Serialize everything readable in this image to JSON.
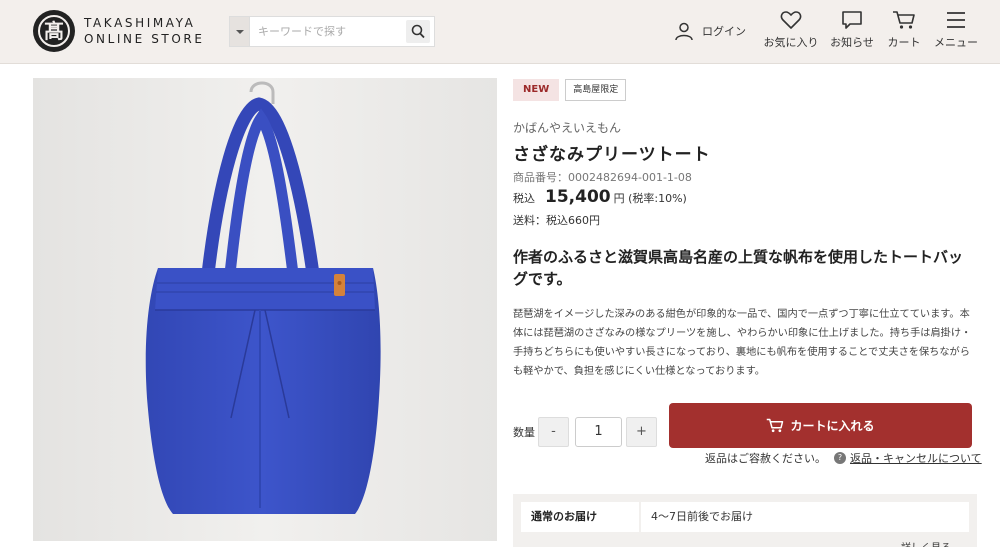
{
  "header": {
    "logo": {
      "mark": "髙",
      "line1": "TAKASHIMAYA",
      "line2": "ONLINE STORE"
    },
    "search": {
      "placeholder": "キーワードで探す"
    },
    "login_label": "ログイン",
    "icons": [
      {
        "name": "favorites",
        "label": "お気に入り"
      },
      {
        "name": "notifications",
        "label": "お知らせ"
      },
      {
        "name": "cart",
        "label": "カート"
      },
      {
        "name": "menu",
        "label": "メニュー"
      }
    ]
  },
  "product": {
    "badge_new": "NEW",
    "badge_limited": "高島屋限定",
    "brand": "かばんやえいえもん",
    "title": "さざなみプリーツトート",
    "number": "商品番号：0002482694-001-1-08",
    "price_tax_label": "税込",
    "price": "15,400",
    "price_unit": "円 (税率:10%)",
    "shipping": "送料：税込660円",
    "catch": "作者のふるさと滋賀県高島名産の上質な帆布を使用したトートバッグです。",
    "description": "琵琶湖をイメージした深みのある紺色が印象的な一品で、国内で一点ずつ丁寧に仕立てています。本体には琵琶湖のさざなみの様なプリーツを施し、やわらかい印象に仕上げました。持ち手は肩掛け・手持ちどちらにも使いやすい長さになっており、裏地にも帆布を使用することで丈夫さを保ちながらも軽やかで、負担を感じにくい仕様となっております。",
    "image": {
      "bag_color": "#3b52c4",
      "tab_color": "#d4823a"
    }
  },
  "purchase": {
    "qty_label": "数量",
    "minus": "-",
    "qty_value": "1",
    "plus": "+",
    "cart_button": "カートに入れる",
    "return_note": "返品はご容赦ください。",
    "return_link": "返品・キャンセルについて"
  },
  "delivery": {
    "key": "通常のお届け",
    "value": "4〜7日前後でお届け",
    "more": "詳しく見る"
  },
  "colors": {
    "accent": "#a3302e",
    "header_bg": "#f3efec"
  }
}
